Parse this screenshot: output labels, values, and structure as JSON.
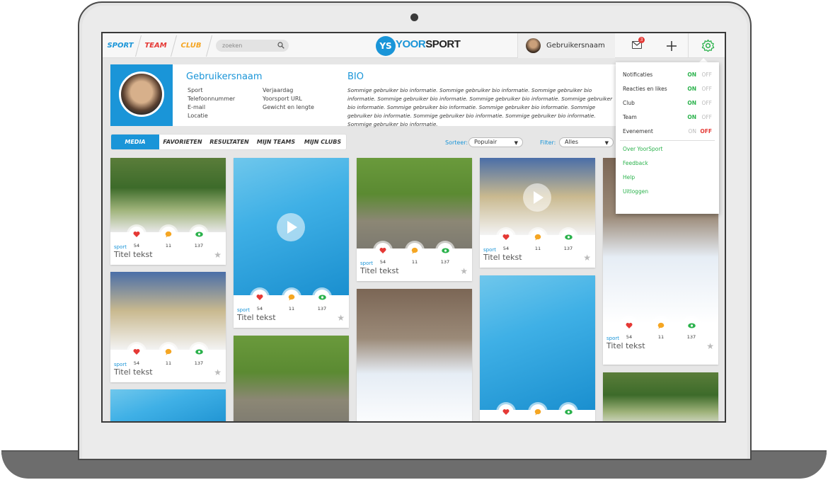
{
  "nav": {
    "tabs": [
      {
        "label": "SPORT",
        "color": "#1a95d8"
      },
      {
        "label": "TEAM",
        "color": "#e53935"
      },
      {
        "label": "CLUB",
        "color": "#f5a623"
      }
    ],
    "search_placeholder": "zoeken",
    "logo_mark": "YS",
    "logo_yoor": "YOOR",
    "logo_sport": "SPORT",
    "username": "Gebruikersnaam",
    "mail_badge": "3"
  },
  "profile": {
    "name": "Gebruikersnaam",
    "col1": [
      "Sport",
      "Telefoonnummer",
      "E-mail",
      "Locatie"
    ],
    "col2": [
      "Verjaardag",
      "Yoorsport URL",
      "Gewicht en lengte"
    ],
    "bio_title": "BIO",
    "bio_text": "Sommige gebruiker bio informatie. Sommige gebruiker bio informatie. Sommige gebruiker bio informatie. Sommige gebruiker bio informatie. Sommige gebruiker bio informatie. Sommige gebruiker bio informatie. Sommige gebruiker bio informatie. Sommige gebruiker bio informatie. Sommige gebruiker bio informatie. Sommige gebruiker bio informatie. Sommige gebruiker bio informatie. Sommige gebruiker bio informatie."
  },
  "tabs": [
    "MEDIA",
    "FAVORIETEN",
    "RESULTATEN",
    "MIJN TEAMS",
    "MIJN CLUBS"
  ],
  "filters": {
    "sort_label": "Sorteer:",
    "sort_value": "Populair",
    "filter_label": "Filter:",
    "filter_value": "Alles"
  },
  "card": {
    "likes": "54",
    "comments": "11",
    "views": "137",
    "tag": "sport",
    "title": "Titel tekst"
  },
  "settings": {
    "toggles": [
      {
        "label": "Notificaties",
        "on": "ON",
        "off": "OFF",
        "state": "on"
      },
      {
        "label": "Reacties en likes",
        "on": "ON",
        "off": "OFF",
        "state": "on"
      },
      {
        "label": "Club",
        "on": "ON",
        "off": "OFF",
        "state": "on"
      },
      {
        "label": "Team",
        "on": "ON",
        "off": "OFF",
        "state": "on"
      },
      {
        "label": "Evenement",
        "on": "ON",
        "off": "OFF",
        "state": "off"
      }
    ],
    "links": [
      "Over YoorSport",
      "Feedback",
      "Help",
      "Uitloggen"
    ]
  },
  "colors": {
    "brand_blue": "#1a95d8",
    "on_green": "#2bb24c",
    "off_red": "#e53935",
    "like_red": "#e53935",
    "comment_orange": "#f5a623",
    "view_green": "#2bb24c"
  }
}
